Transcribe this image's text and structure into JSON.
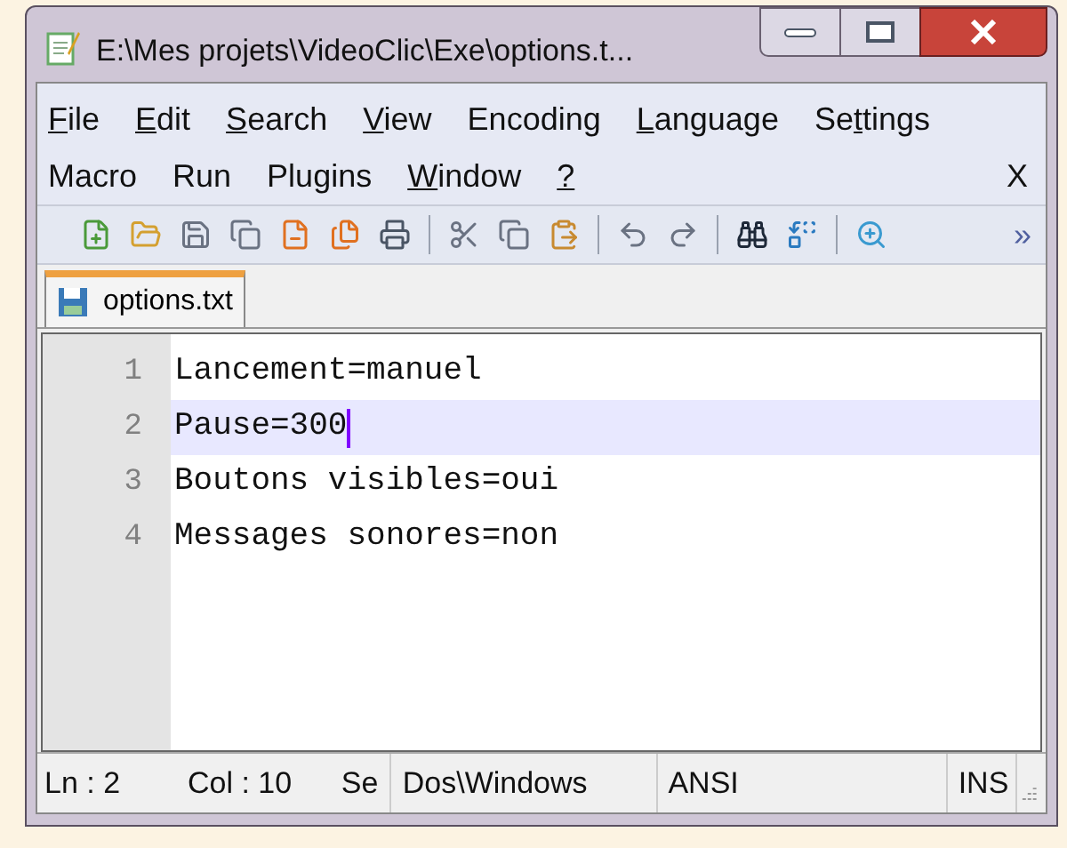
{
  "window": {
    "title": "E:\\Mes projets\\VideoClic\\Exe\\options.t..."
  },
  "menu_rows": [
    [
      {
        "key": "F",
        "post": "ile"
      },
      {
        "key": "E",
        "post": "dit"
      },
      {
        "key": "S",
        "post": "earch"
      },
      {
        "key": "V",
        "post": "iew"
      },
      {
        "pre": "Encoding"
      },
      {
        "key": "L",
        "post": "anguage"
      },
      {
        "pre": "Se",
        "key": "t",
        "post": "tings"
      }
    ],
    [
      {
        "pre": "Macro"
      },
      {
        "pre": "Run"
      },
      {
        "pre": "Plugins"
      },
      {
        "key": "W",
        "post": "indow"
      },
      {
        "key": "?"
      }
    ]
  ],
  "close_doc": "X",
  "toolbar_overflow": "»",
  "tabs": [
    {
      "label": "options.txt",
      "selected": true
    }
  ],
  "lines": [
    {
      "number": "1",
      "text": "Lancement=manuel",
      "current": false
    },
    {
      "number": "2",
      "text": "Pause=300",
      "current": true
    },
    {
      "number": "3",
      "text": "Boutons visibles=oui",
      "current": false
    },
    {
      "number": "4",
      "text": "Messages sonores=non",
      "current": false
    }
  ],
  "status_bar": [
    "Ln : 2",
    "Col : 10",
    "Se",
    "Dos\\Windows",
    "ANSI",
    "INS"
  ]
}
